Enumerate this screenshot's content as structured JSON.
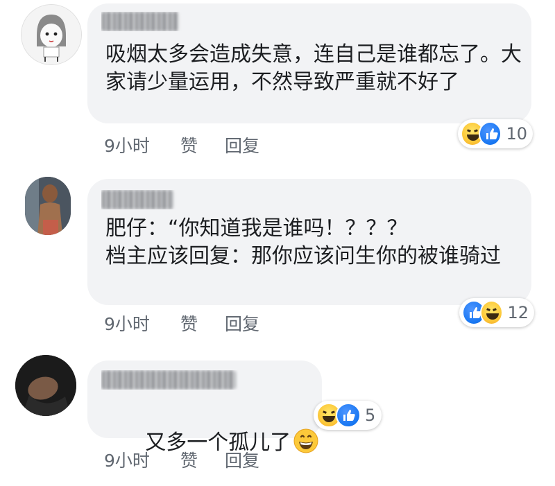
{
  "comments": [
    {
      "author": "user",
      "text": "吸烟太多会造成失意，连自己是谁都忘了。大家请少量运用，不然导致严重就不好了",
      "time": "9小时",
      "like": "赞",
      "reply": "回复",
      "reactions": [
        "haha-icon",
        "like-icon"
      ],
      "reaction_count": "10"
    },
    {
      "author": "user",
      "text": "肥仔：“你知道我是谁吗！？？？\n档主应该回复：那你应该问生你的被谁骑过",
      "time": "9小时",
      "like": "赞",
      "reply": "回复",
      "reactions": [
        "like-icon",
        "haha-icon"
      ],
      "reaction_count": "12"
    },
    {
      "author": "user",
      "text": "又多一个孤儿了",
      "emoji": "grinning-face-emoji",
      "time": "9小时",
      "like": "赞",
      "reply": "回复",
      "reactions": [
        "haha-icon",
        "like-icon"
      ],
      "reaction_count": "5"
    }
  ],
  "colors": {
    "bubble": "#f2f3f5",
    "text": "#1c1e21",
    "meta": "#606770",
    "like_blue": "#1877f2",
    "haha_yellow": "#fcc93a"
  }
}
